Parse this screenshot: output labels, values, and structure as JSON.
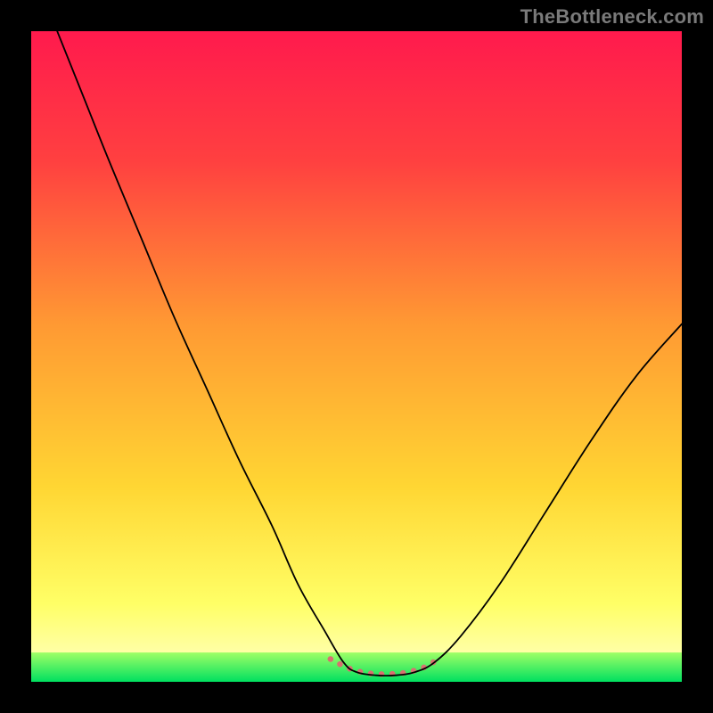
{
  "watermark": "TheBottleneck.com",
  "chart_data": {
    "type": "line",
    "title": "",
    "xlabel": "",
    "ylabel": "",
    "xlim": [
      0,
      100
    ],
    "ylim": [
      0,
      100
    ],
    "grid": false,
    "legend": false,
    "background": {
      "gradient_stops": [
        {
          "pos": 0.0,
          "color": "#ff1a4d"
        },
        {
          "pos": 0.2,
          "color": "#ff4040"
        },
        {
          "pos": 0.45,
          "color": "#ff9933"
        },
        {
          "pos": 0.7,
          "color": "#ffd633"
        },
        {
          "pos": 0.88,
          "color": "#ffff66"
        },
        {
          "pos": 1.0,
          "color": "#ffffcc"
        }
      ],
      "bottom_band": {
        "start_color": "#9fff66",
        "end_color": "#00e060",
        "y_frac_top": 0.955,
        "y_frac_bottom": 1.0
      }
    },
    "series": [
      {
        "name": "bottleneck-curve",
        "stroke": "#000000",
        "stroke_width": 1.8,
        "points": [
          {
            "x": 4,
            "y": 100
          },
          {
            "x": 8,
            "y": 90
          },
          {
            "x": 12,
            "y": 80
          },
          {
            "x": 17,
            "y": 68
          },
          {
            "x": 22,
            "y": 56
          },
          {
            "x": 27,
            "y": 45
          },
          {
            "x": 32,
            "y": 34
          },
          {
            "x": 37,
            "y": 24
          },
          {
            "x": 41,
            "y": 15
          },
          {
            "x": 45,
            "y": 8
          },
          {
            "x": 48,
            "y": 3
          },
          {
            "x": 50,
            "y": 1.5
          },
          {
            "x": 53,
            "y": 1
          },
          {
            "x": 56,
            "y": 1
          },
          {
            "x": 59,
            "y": 1.5
          },
          {
            "x": 62,
            "y": 3
          },
          {
            "x": 66,
            "y": 7
          },
          {
            "x": 72,
            "y": 15
          },
          {
            "x": 79,
            "y": 26
          },
          {
            "x": 86,
            "y": 37
          },
          {
            "x": 93,
            "y": 47
          },
          {
            "x": 100,
            "y": 55
          }
        ]
      },
      {
        "name": "flat-highlight",
        "stroke": "#d77070",
        "stroke_width": 6.5,
        "linecap": "round",
        "dash": "0.1 12",
        "points": [
          {
            "x": 46,
            "y": 3.5
          },
          {
            "x": 49,
            "y": 2.0
          },
          {
            "x": 52,
            "y": 1.3
          },
          {
            "x": 55,
            "y": 1.2
          },
          {
            "x": 58,
            "y": 1.5
          },
          {
            "x": 61,
            "y": 2.5
          },
          {
            "x": 63,
            "y": 4.0
          }
        ]
      }
    ]
  }
}
